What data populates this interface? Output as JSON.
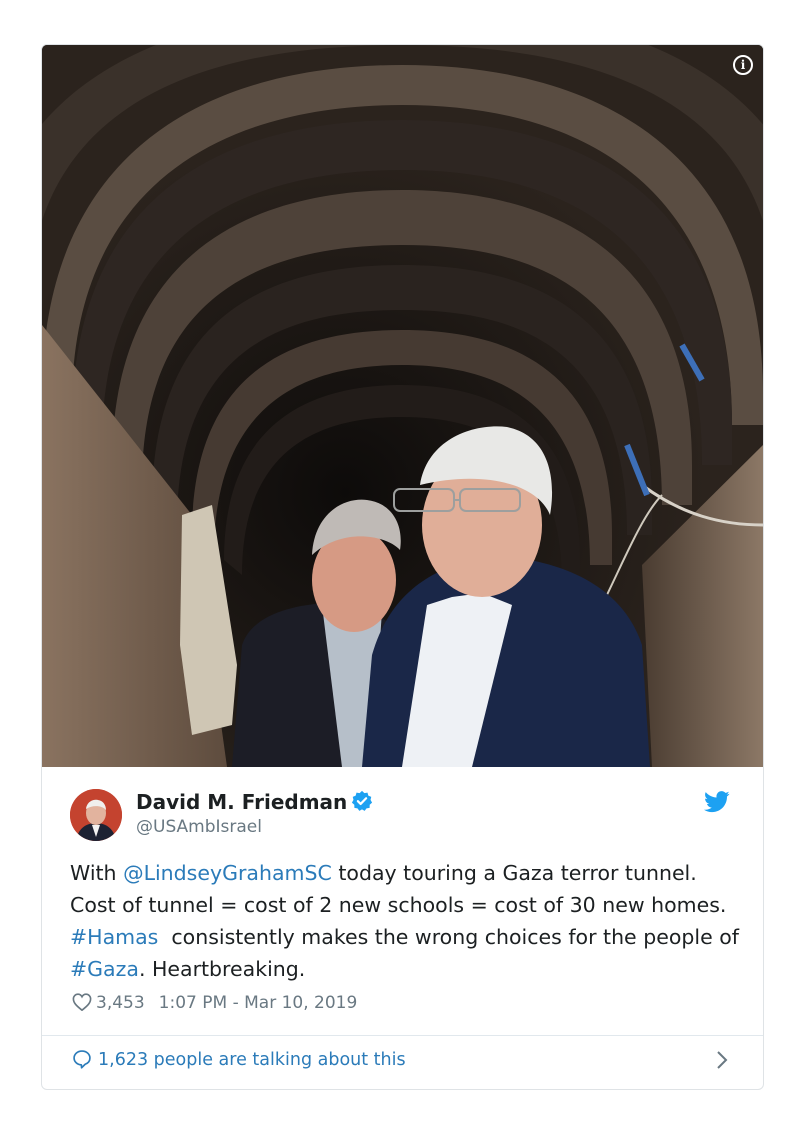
{
  "tweet": {
    "author_name": "David M. Friedman",
    "author_handle": "@USAmbIsrael",
    "text": {
      "p1": "With ",
      "mention": "@LindseyGrahamSC",
      "p2": " today touring a Gaza terror tunnel. Cost of tunnel = cost of 2 new schools = cost of 30 new homes. ",
      "hashtag1": "#Hamas",
      "p3": "  consistently makes the wrong choices for the people of ",
      "hashtag2": "#Gaza",
      "p4": ". Heartbreaking."
    },
    "likes": "3,453",
    "timestamp": "1:07 PM - Mar 10, 2019",
    "talking": "1,623 people are talking about this"
  },
  "icons": {
    "info": "info-icon",
    "verified": "verified-badge-icon",
    "bird": "twitter-bird-icon",
    "heart": "heart-icon",
    "bubble": "speech-bubble-icon",
    "chevron": "chevron-right-icon"
  },
  "colors": {
    "link": "#2b7bb9",
    "muted": "#697882",
    "text": "#1c2022",
    "twitter_blue": "#1da1f2"
  }
}
